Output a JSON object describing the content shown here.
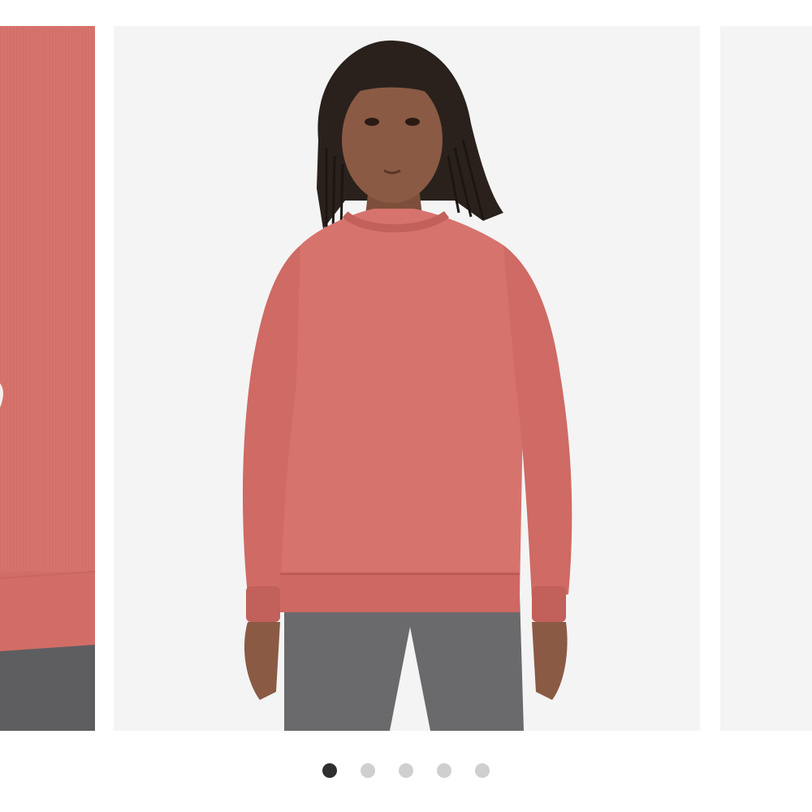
{
  "carousel": {
    "current_index": 1,
    "total_slides": 5,
    "slides": [
      {
        "label": ""
      },
      {
        "label": ""
      },
      {
        "label": ""
      }
    ]
  },
  "colors": {
    "sweater": "#d7736d",
    "sweater_shadow": "#c2605b",
    "leggings": "#6a6a6c",
    "skin": "#8a5a44",
    "hair": "#2a211c",
    "photo_background": "#f4f4f4",
    "dot_active": "#2e2e2e",
    "dot_inactive": "#cfcfcf"
  }
}
